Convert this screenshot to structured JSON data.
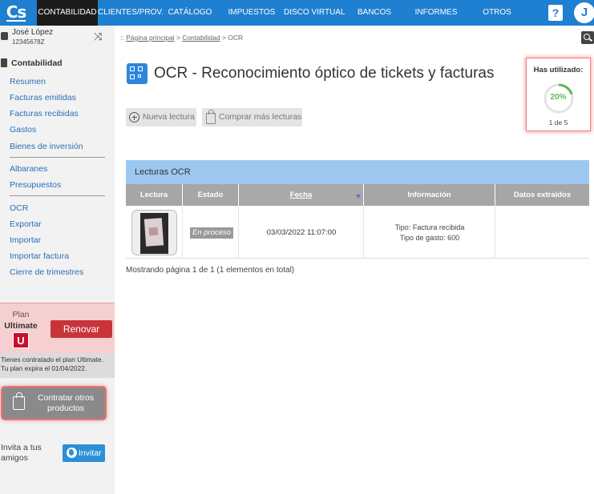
{
  "logo": {
    "text": "Cs"
  },
  "nav": {
    "items": [
      {
        "label": "CONTABILIDAD"
      },
      {
        "label": "CLIENTES/PROV."
      },
      {
        "label": "CATÁLOGO"
      },
      {
        "label": "IMPUESTOS"
      },
      {
        "label": "DISCO VIRTUAL"
      },
      {
        "label": "BANCOS"
      },
      {
        "label": "INFORMES"
      },
      {
        "label": "OTROS"
      }
    ],
    "help": "?",
    "avatar": "J"
  },
  "user": {
    "name": "José López",
    "id": "12345678Z"
  },
  "sidebar": {
    "section_title": "Contabilidad",
    "group1": [
      "Resumen",
      "Facturas emitidas",
      "Facturas recibidas",
      "Gastos",
      "Bienes de inversión"
    ],
    "group2": [
      "Albaranes",
      "Presupuestos"
    ],
    "group3": [
      "OCR",
      "Exportar",
      "Importar",
      "Importar factura",
      "Cierre de trimestres"
    ]
  },
  "plan": {
    "label": "Plan",
    "name": "Ultimate",
    "badge": "U",
    "renew_label": "Renovar",
    "info_line1": "Tienes contratado el plan Ultimate.",
    "info_line2": "Tu plan expira el 01/04/2022."
  },
  "contract": {
    "label_line1": "Contratar otros",
    "label_line2": "productos"
  },
  "invite": {
    "text_line1": "Invita a tus",
    "text_line2": "amigos",
    "button_label": "Invitar"
  },
  "breadcrumb": {
    "prefix": "::",
    "home": "Página principal",
    "sep": ">",
    "section": "Contabilidad",
    "current": "OCR"
  },
  "page": {
    "title": "OCR - Reconocimiento óptico de tickets y facturas"
  },
  "usage": {
    "title": "Has utilizado:",
    "percent_label": "20%",
    "percent": 0.2,
    "count": "1 de 5",
    "color": "#5cb85c"
  },
  "toolbar": {
    "new_label": "Nueva lectura",
    "buy_label": "Comprar más lecturas"
  },
  "table": {
    "caption": "Lecturas OCR",
    "columns": [
      "Lectura",
      "Estado",
      "Fecha",
      "Información",
      "Datos extraídos"
    ],
    "rows": [
      {
        "estado": "En proceso",
        "fecha": "03/03/2022 11:07:00",
        "info_line1": "Tipo: Factura recibida",
        "info_line2": "Tipo de gasto: 600",
        "datos": ""
      }
    ],
    "pager": "Mostrando página 1 de 1 (1 elementos en total)"
  }
}
